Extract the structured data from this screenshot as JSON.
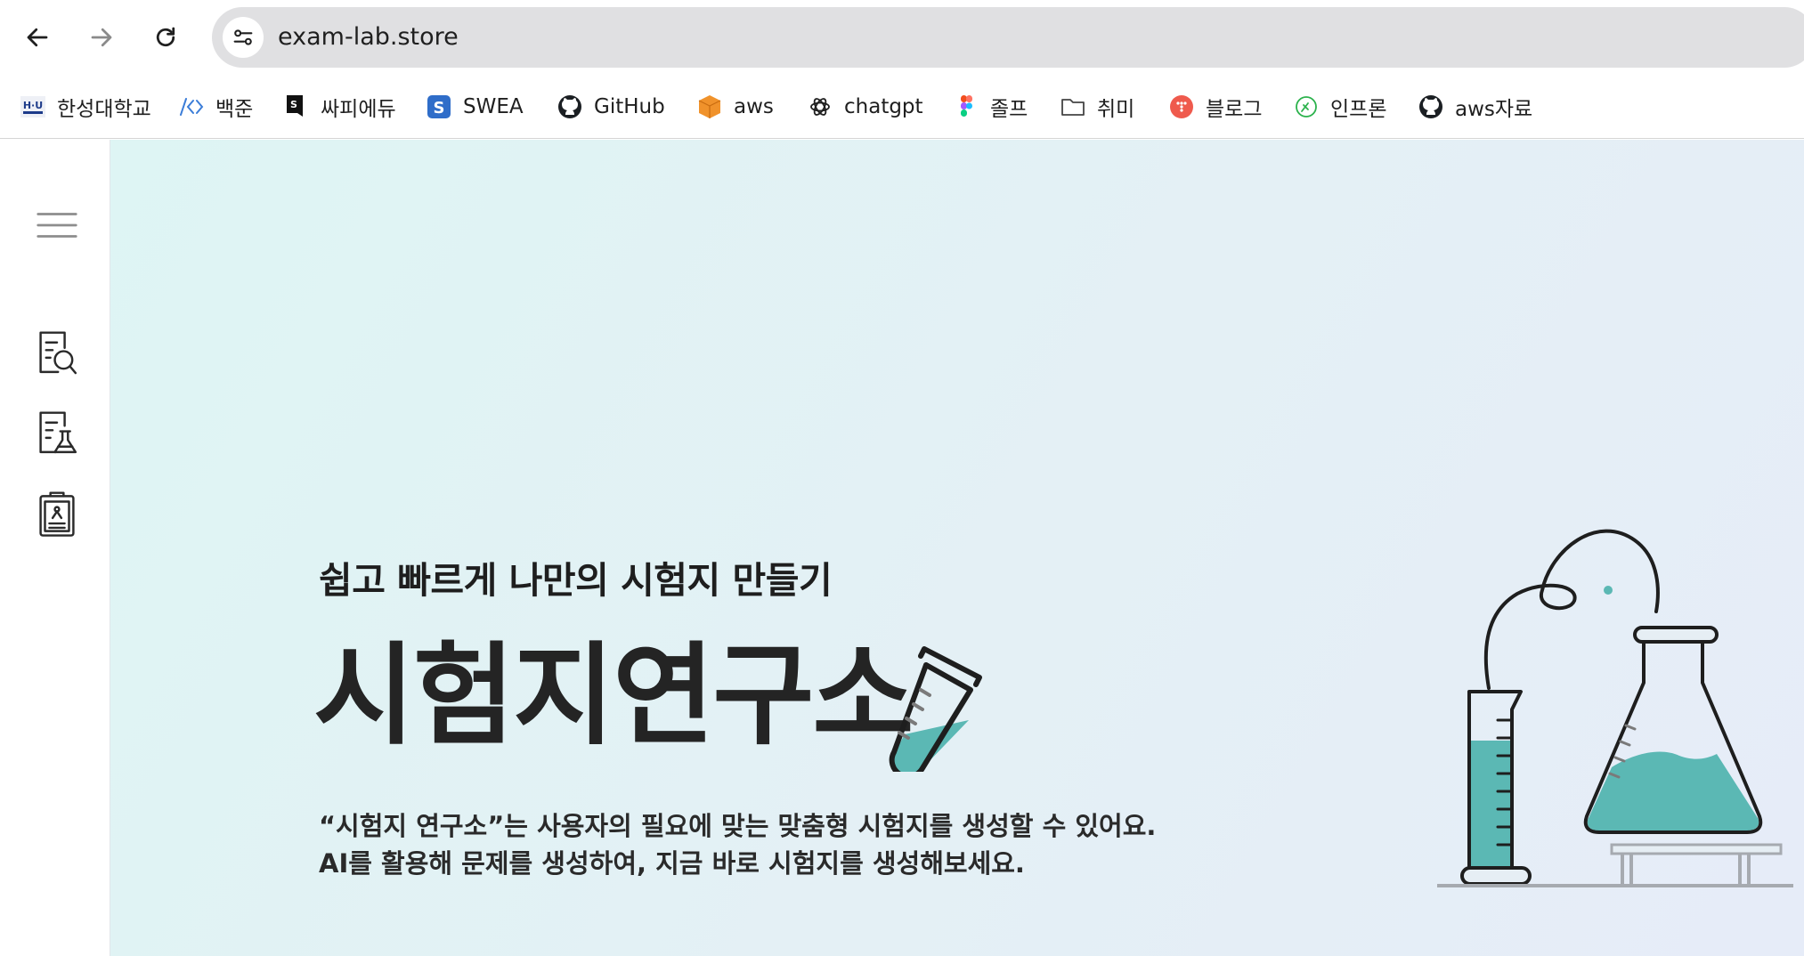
{
  "browser": {
    "url": "exam-lab.store",
    "nav": {
      "back_icon": "arrow-left-icon",
      "forward_icon": "arrow-right-icon",
      "reload_icon": "reload-icon"
    },
    "bookmarks": [
      {
        "label": "한성대학교",
        "icon": "hansung-logo-icon"
      },
      {
        "label": "백준",
        "icon": "code-brackets-icon"
      },
      {
        "label": "싸피에듀",
        "icon": "ssafy-logo-icon"
      },
      {
        "label": "SWEA",
        "icon": "swea-logo-icon"
      },
      {
        "label": "GitHub",
        "icon": "github-icon"
      },
      {
        "label": "aws",
        "icon": "aws-box-icon"
      },
      {
        "label": "chatgpt",
        "icon": "openai-icon"
      },
      {
        "label": "졸프",
        "icon": "figma-icon"
      },
      {
        "label": "취미",
        "icon": "folder-icon"
      },
      {
        "label": "블로그",
        "icon": "blog-icon"
      },
      {
        "label": "인프론",
        "icon": "inflearn-icon"
      },
      {
        "label": "aws자료",
        "icon": "github-icon"
      }
    ]
  },
  "sidebar": {
    "items": [
      {
        "icon": "menu-icon"
      },
      {
        "icon": "document-search-icon"
      },
      {
        "icon": "document-flask-icon"
      },
      {
        "icon": "clipboard-icon"
      }
    ]
  },
  "hero": {
    "tagline": "쉽고 빠르게 나만의 시험지 만들기",
    "title": "시험지연구소",
    "description_line1": "“시험지 연구소”는 사용자의 필요에 맞는 맞춤형 시험지를 생성할 수 있어요.",
    "description_line2": "AI를 활용해 문제를 생성하여, 지금 바로 시험지를 생성해보세요.",
    "accent_color": "#5bb8b4",
    "illustrations": [
      "test-tube-icon",
      "lab-equipment-illustration"
    ]
  }
}
